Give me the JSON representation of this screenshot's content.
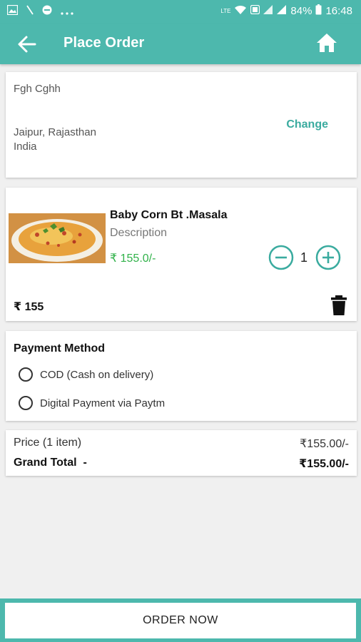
{
  "status_bar": {
    "battery": "84%",
    "time": "16:48",
    "network": "LTE",
    "left_icons": [
      "image-icon",
      "slash-icon",
      "minus-circle-icon",
      "more-dots-icon"
    ]
  },
  "app_bar": {
    "title": "Place Order",
    "back_icon": "arrow-left-icon",
    "home_icon": "home-icon"
  },
  "address": {
    "name": "Fgh Cghh",
    "line1": "Jaipur, Rajasthan",
    "line2": "India",
    "change_label": "Change"
  },
  "cart_item": {
    "name": "Baby Corn Bt .Masala",
    "description": "Description",
    "price": "₹ 155.0/-",
    "quantity": "1",
    "total": "₹ 155"
  },
  "payment": {
    "title": "Payment Method",
    "options": [
      {
        "label": "COD (Cash on delivery)",
        "selected": false
      },
      {
        "label": "Digital Payment via Paytm",
        "selected": false
      }
    ]
  },
  "summary": {
    "price_label": "Price (1 item)",
    "price_value": "₹155.00/-",
    "grand_total_label": "Grand Total  -",
    "grand_total_value": "₹155.00/-"
  },
  "order_button": {
    "label": "ORDER NOW"
  },
  "colors": {
    "accent": "#4db8ad",
    "change_link": "#3aab9f",
    "price_green": "#31b24a"
  }
}
